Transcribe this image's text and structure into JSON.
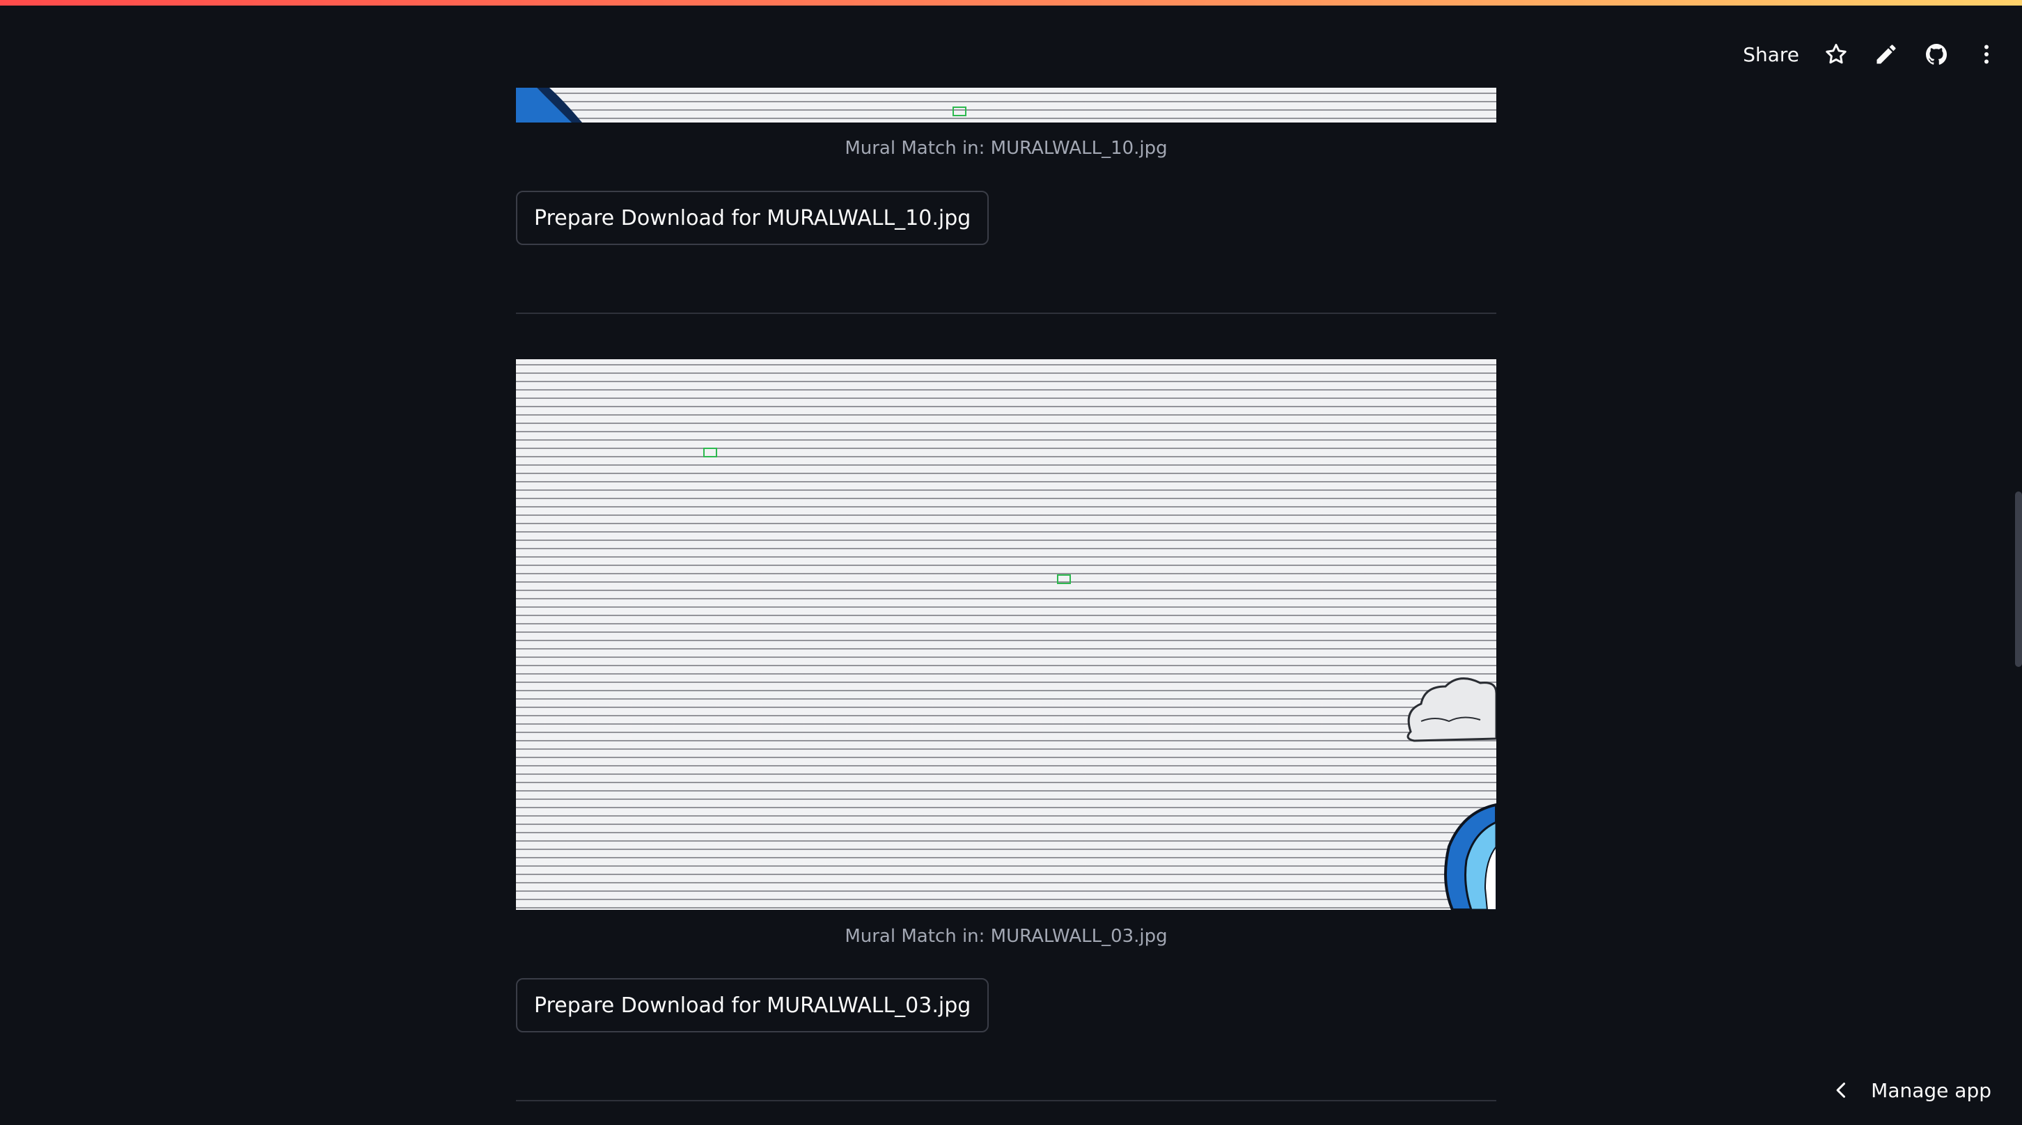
{
  "toolbar": {
    "share_label": "Share",
    "icons": [
      "star-icon",
      "pencil-icon",
      "github-icon",
      "more-vertical-icon"
    ]
  },
  "results": [
    {
      "caption": "Mural Match in: MURALWALL_10.jpg",
      "button_label": "Prepare Download for MURALWALL_10.jpg"
    },
    {
      "caption": "Mural Match in: MURALWALL_03.jpg",
      "button_label": "Prepare Download for MURALWALL_03.jpg"
    }
  ],
  "footer": {
    "manage_app_label": "Manage app"
  },
  "colors": {
    "background": "#0e1117",
    "caption": "#a3a8b4",
    "button_border": "#3a3d47",
    "match_highlight": "#2db84f"
  }
}
